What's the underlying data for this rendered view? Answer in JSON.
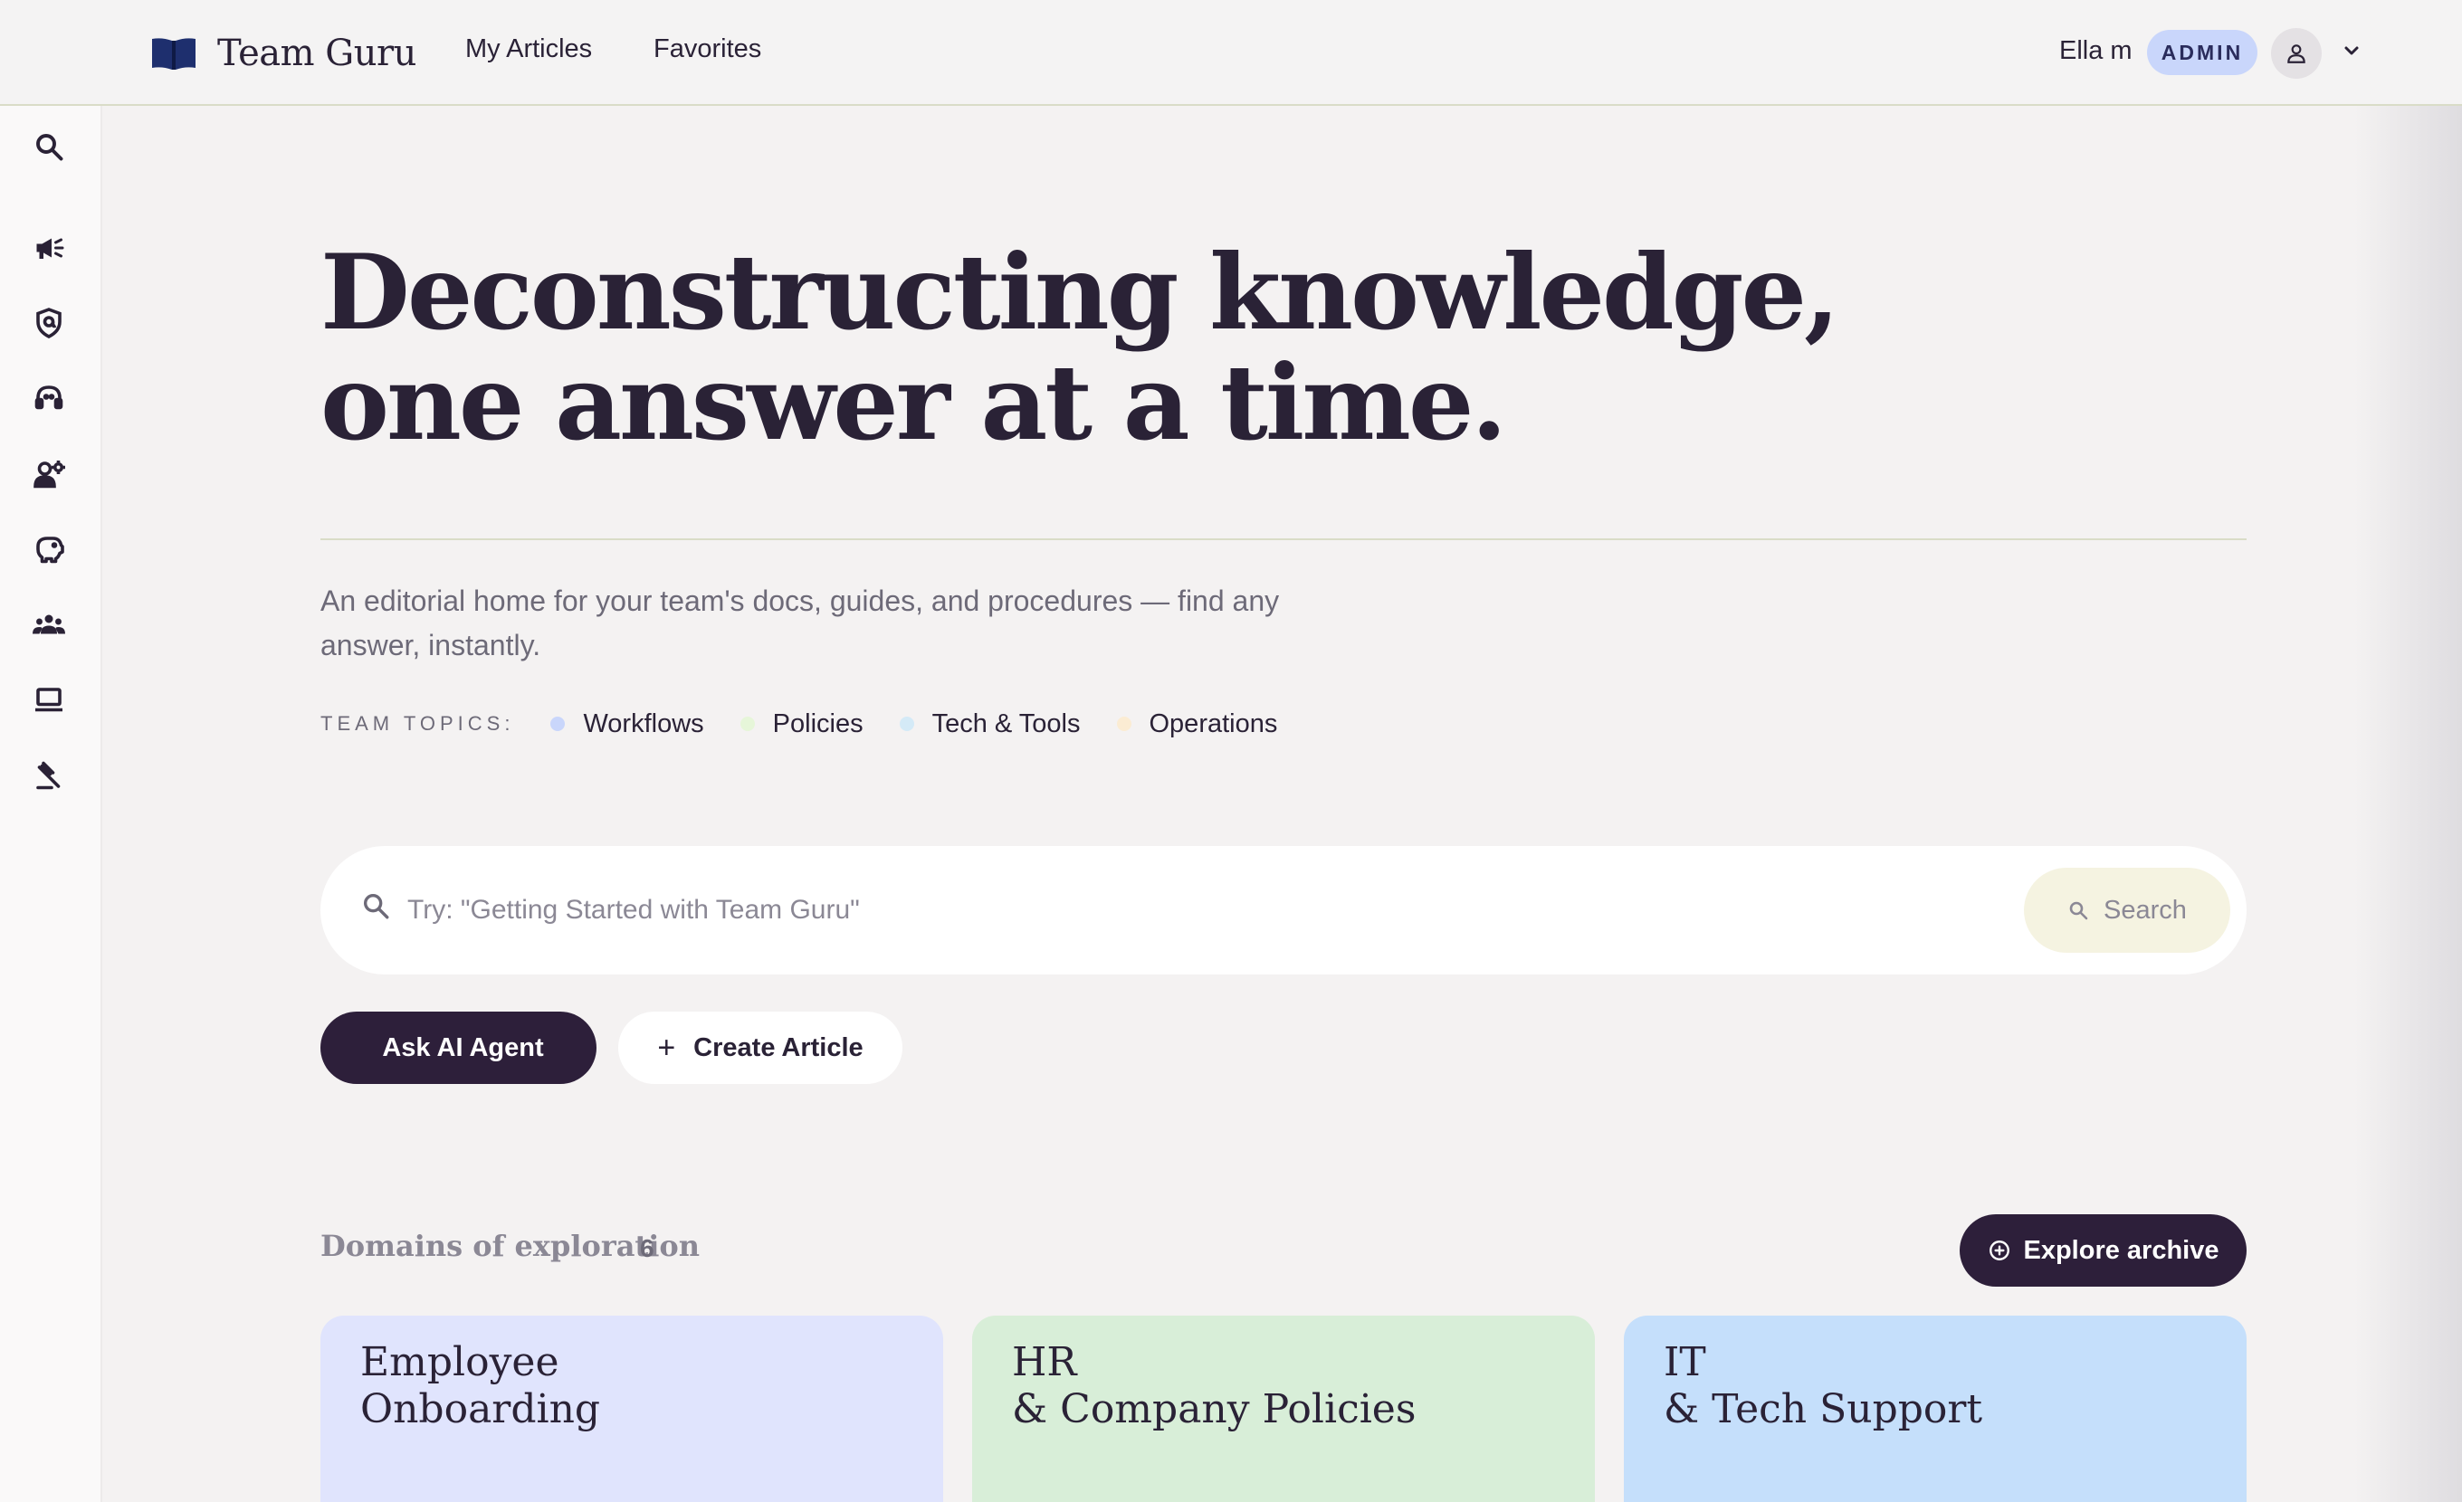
{
  "header": {
    "brand": "Team Guru",
    "nav": [
      "My Articles",
      "Favorites"
    ],
    "user_name": "Ella m",
    "role_badge": "ADMIN"
  },
  "sidebar": {
    "icons": [
      "search-icon",
      "megaphone-icon",
      "shield-icon",
      "headset-icon",
      "user-gear-icon",
      "piggy-bank-icon",
      "team-icon",
      "laptop-icon",
      "gavel-icon"
    ]
  },
  "hero": {
    "line1": "Deconstructing knowledge,",
    "line2": "one answer at a time.",
    "description": "An editorial home for your team's docs, guides, and procedures — find any answer, instantly."
  },
  "topics": {
    "label": "TEAM TOPICS:",
    "items": [
      {
        "label": "Workflows",
        "color": "#c9d6fb"
      },
      {
        "label": "Policies",
        "color": "#e6f6d9"
      },
      {
        "label": "Tech & Tools",
        "color": "#d4eaf7"
      },
      {
        "label": "Operations",
        "color": "#fbecd3"
      }
    ]
  },
  "search": {
    "placeholder": "Try: \"Getting Started with Team Guru\"",
    "button": "Search"
  },
  "actions": {
    "ask": "Ask AI Agent",
    "create": "Create Article"
  },
  "domains": {
    "title": "Domains of exploration",
    "count": "6",
    "explore": "Explore archive",
    "cards": [
      {
        "line1": "Employee",
        "line2": "Onboarding",
        "color": "#e0e4fd"
      },
      {
        "line1": "HR",
        "line2": "& Company Policies",
        "color": "#d8eed8"
      },
      {
        "line1": "IT",
        "line2": "& Tech Support",
        "color": "#c5dffb"
      }
    ]
  },
  "colors": {
    "ink": "#2a2236",
    "dark_button": "#2d1f3a",
    "brand_icon": "#1e2f6e"
  }
}
